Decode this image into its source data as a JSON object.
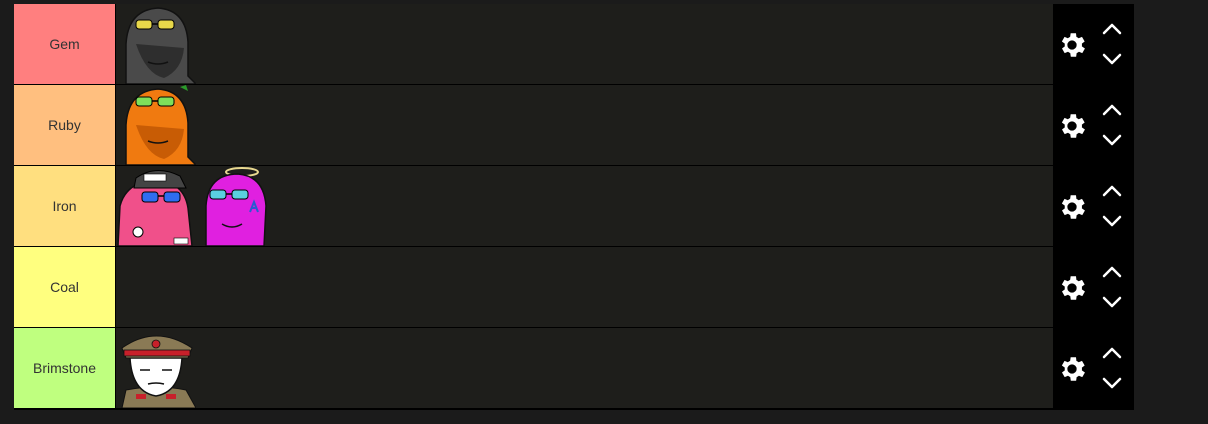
{
  "colors": {
    "page_bg": "#1b1b1b",
    "row_bg": "#1e1e1b",
    "controls_bg": "#000000"
  },
  "tiers": [
    {
      "label": "Gem",
      "color": "#ff7f7f",
      "items": [
        {
          "icon": "black-wojak-sunglasses"
        }
      ]
    },
    {
      "label": "Ruby",
      "color": "#ffbf7f",
      "items": [
        {
          "icon": "orange-wojak-sunglasses"
        }
      ]
    },
    {
      "label": "Iron",
      "color": "#ffdf7f",
      "items": [
        {
          "icon": "pink-wojak-cap"
        },
        {
          "icon": "magenta-wojak-halo"
        }
      ]
    },
    {
      "label": "Coal",
      "color": "#ffff7f",
      "items": []
    },
    {
      "label": "Brimstone",
      "color": "#bfff7f",
      "items": [
        {
          "icon": "soldier-wojak-cap"
        }
      ]
    }
  ]
}
